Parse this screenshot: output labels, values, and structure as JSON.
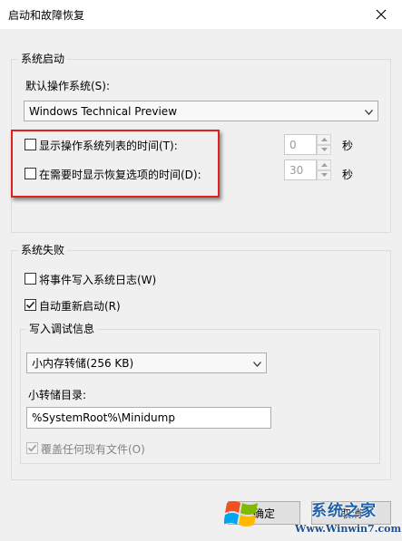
{
  "window": {
    "title": "启动和故障恢复"
  },
  "startup": {
    "legend": "系统启动",
    "default_os_label": "默认操作系统(S):",
    "default_os_value": "Windows Technical Preview",
    "show_os_list_label": "显示操作系统列表的时间(T):",
    "show_os_list_value": "0",
    "show_os_list_unit": "秒",
    "show_recovery_label": "在需要时显示恢复选项的时间(D):",
    "show_recovery_value": "30",
    "show_recovery_unit": "秒"
  },
  "failure": {
    "legend": "系统失败",
    "write_event_label": "将事件写入系统日志(W)",
    "auto_restart_label": "自动重新启动(R)",
    "debug": {
      "legend": "写入调试信息",
      "dump_type_value": "小内存转储(256 KB)",
      "dump_dir_label": "小转储目录:",
      "dump_dir_value": "%SystemRoot%\\Minidump",
      "overwrite_label": "覆盖任何现有文件(O)"
    }
  },
  "buttons": {
    "ok": "确定",
    "cancel": "取消"
  },
  "watermark": {
    "brand": "系统之家",
    "url": "Www.Winwin7.com"
  }
}
